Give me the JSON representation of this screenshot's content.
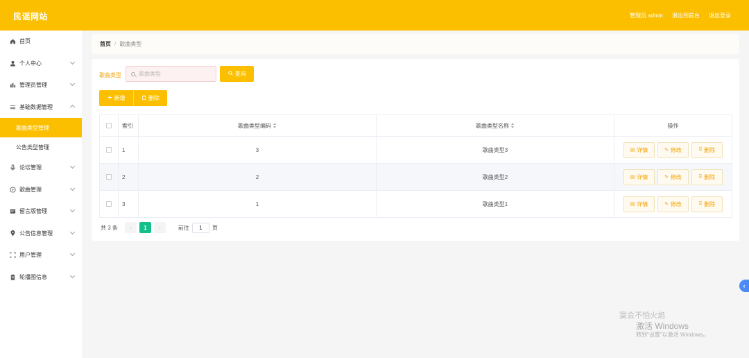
{
  "header": {
    "brand": "民谣网站",
    "user_label": "管理员 admin",
    "to_front": "退出到前台",
    "logout": "退出登录"
  },
  "sidebar": {
    "items": [
      {
        "label": "首页",
        "icon": "home-icon",
        "has_arrow": false
      },
      {
        "label": "个人中心",
        "icon": "user-icon",
        "has_arrow": true
      },
      {
        "label": "管理员管理",
        "icon": "admin-icon",
        "has_arrow": true
      },
      {
        "label": "基础数据管理",
        "icon": "list-icon",
        "has_arrow": true,
        "expanded": true,
        "children": [
          {
            "label": "歌曲类型管理",
            "active": true
          },
          {
            "label": "公告类型管理",
            "active": false
          }
        ]
      },
      {
        "label": "论坛管理",
        "icon": "mic-icon",
        "has_arrow": true
      },
      {
        "label": "歌曲管理",
        "icon": "compass-icon",
        "has_arrow": true
      },
      {
        "label": "留言版管理",
        "icon": "board-icon",
        "has_arrow": true
      },
      {
        "label": "公告信息管理",
        "icon": "pin-icon",
        "has_arrow": true
      },
      {
        "label": "用户管理",
        "icon": "frame-icon",
        "has_arrow": true
      },
      {
        "label": "轮播图信息",
        "icon": "clipboard-icon",
        "has_arrow": true
      }
    ]
  },
  "breadcrumb": {
    "home": "首页",
    "separator": "/",
    "current": "歌曲类型"
  },
  "search": {
    "label": "歌曲类型",
    "placeholder": "歌曲类型",
    "query_button": "查询"
  },
  "actions": {
    "add": "新增",
    "delete": "删除"
  },
  "table": {
    "headers": {
      "index": "索引",
      "code": "歌曲类型编码",
      "name": "歌曲类型名称",
      "ops": "操作"
    },
    "rows": [
      {
        "index": "1",
        "code": "3",
        "name": "歌曲类型3"
      },
      {
        "index": "2",
        "code": "2",
        "name": "歌曲类型2"
      },
      {
        "index": "3",
        "code": "1",
        "name": "歌曲类型1"
      }
    ],
    "row_actions": {
      "detail": "详情",
      "edit": "修改",
      "delete": "删除"
    }
  },
  "pagination": {
    "total_text": "共 3 条",
    "current_page": "1",
    "goto_label": "前往",
    "goto_value": "1",
    "page_suffix": "页"
  },
  "watermark": {
    "line1": "寞会不怕火焰",
    "line2": "激活 Windows",
    "line3": "转到\"设置\"以激活 Windows。"
  },
  "colors": {
    "accent": "#fbbf00",
    "page_active": "#13c08a",
    "float_tab": "#4a8bf5"
  }
}
